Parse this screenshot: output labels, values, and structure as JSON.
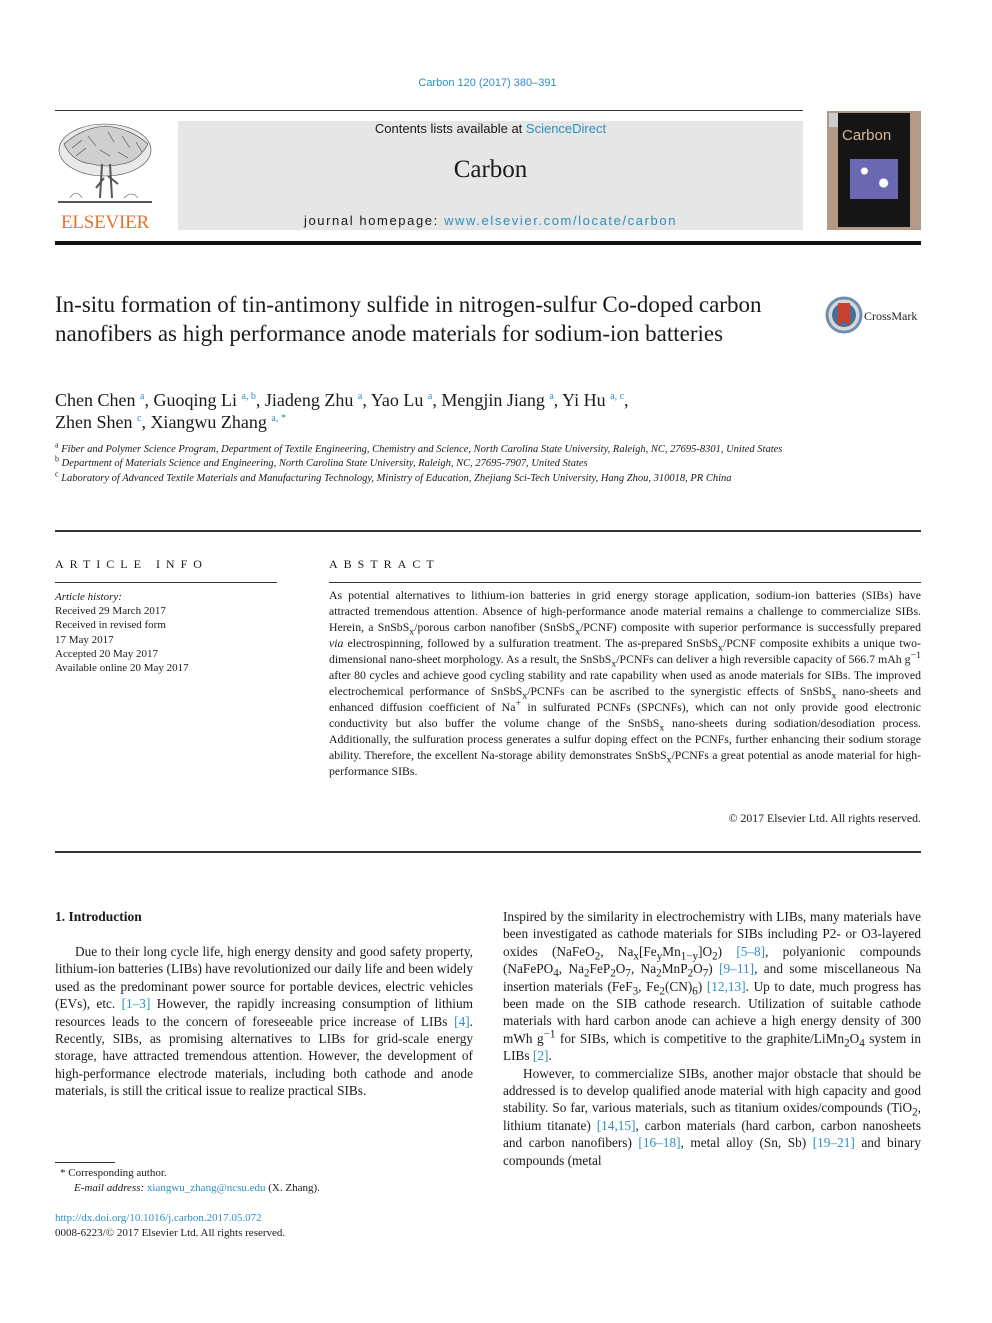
{
  "citation": "Carbon 120 (2017) 380–391",
  "header": {
    "publisher_logo_text": "ELSEVIER",
    "contents_prefix": "Contents lists available at ",
    "contents_link": "ScienceDirect",
    "journal_name": "Carbon",
    "homepage_prefix": "journal homepage: ",
    "homepage_link": "www.elsevier.com/locate/carbon",
    "cover_title": "Carbon",
    "colors": {
      "link": "#2c8fbf",
      "elsevier_orange": "#e8722d",
      "header_box": "#e6e6e6",
      "cover_frame": "#b39a86"
    }
  },
  "article": {
    "title": "In-situ formation of tin-antimony sulfide in nitrogen-sulfur Co-doped carbon nanofibers as high performance anode materials for sodium-ion batteries",
    "crossmark_label": "CrossMark",
    "authors": [
      {
        "name": "Chen Chen",
        "aff": "a"
      },
      {
        "name": "Guoqing Li",
        "aff": "a, b"
      },
      {
        "name": "Jiadeng Zhu",
        "aff": "a"
      },
      {
        "name": "Yao Lu",
        "aff": "a"
      },
      {
        "name": "Mengjin Jiang",
        "aff": "a"
      },
      {
        "name": "Yi Hu",
        "aff": "a, c"
      },
      {
        "name": "Zhen Shen",
        "aff": "c"
      },
      {
        "name": "Xiangwu Zhang",
        "aff": "a, *"
      }
    ],
    "affiliations": [
      {
        "key": "a",
        "text": "Fiber and Polymer Science Program, Department of Textile Engineering, Chemistry and Science, North Carolina State University, Raleigh, NC, 27695-8301, United States"
      },
      {
        "key": "b",
        "text": "Department of Materials Science and Engineering, North Carolina State University, Raleigh, NC, 27695-7907, United States"
      },
      {
        "key": "c",
        "text": "Laboratory of Advanced Textile Materials and Manufacturing Technology, Ministry of Education, Zhejiang Sci-Tech University, Hang Zhou, 310018, PR China"
      }
    ]
  },
  "article_info": {
    "heading": "ARTICLE INFO",
    "history_label": "Article history:",
    "history": [
      "Received 29 March 2017",
      "Received in revised form",
      "17 May 2017",
      "Accepted 20 May 2017",
      "Available online 20 May 2017"
    ]
  },
  "abstract": {
    "heading": "ABSTRACT",
    "s1": "As potential alternatives to lithium-ion batteries in grid energy storage application, sodium-ion batteries (SIBs) have attracted tremendous attention. Absence of high-performance anode material remains a challenge to commercialize SIBs. Herein, a SnSbS",
    "s2": "/porous carbon nanofiber (SnSbS",
    "s3": "/PCNF) composite with superior performance is successfully prepared ",
    "s3_via": "via",
    "s4": " electrospinning, followed by a sulfuration treatment. The as-prepared SnSbS",
    "s5": "/PCNF composite exhibits a unique two-dimensional nano-sheet morphology. As a result, the SnSbS",
    "s6": "/PCNFs can deliver a high reversible capacity of 566.7 mAh g",
    "s7": " after 80 cycles and achieve good cycling stability and rate capability when used as anode materials for SIBs. The improved electrochemical performance of SnSbS",
    "s8": "/PCNFs can be ascribed to the synergistic effects of SnSbS",
    "s9": " nano-sheets and enhanced diffusion coefficient of Na",
    "s10": " in sulfurated PCNFs (SPCNFs), which can not only provide good electronic conductivity but also buffer the volume change of the SnSbS",
    "s11": " nano-sheets during sodiation/desodiation process. Additionally, the sulfuration process generates a sulfur doping effect on the PCNFs, further enhancing their sodium storage ability. Therefore, the excellent Na-storage ability demonstrates SnSbS",
    "s12": "/PCNFs a great potential as anode material for high-performance SIBs.",
    "sub_x": "x",
    "sup_minus1": "−1",
    "sup_plus": "+",
    "copyright": "© 2017 Elsevier Ltd. All rights reserved."
  },
  "introduction": {
    "heading": "1.  Introduction",
    "left_p1_a": "Due to their long cycle life, high energy density and good safety property, lithium-ion batteries (LIBs) have revolutionized our daily life and been widely used as the predominant power source for portable devices, electric vehicles (EVs), etc. ",
    "ref_1_3": "[1–3]",
    "left_p1_b": " However, the rapidly increasing consumption of lithium resources leads to the concern of foreseeable price increase of LIBs ",
    "ref_4": "[4]",
    "left_p1_c": ". Recently, SIBs, as promising alternatives to LIBs for grid-scale energy storage, have attracted tremendous attention. However, the development of high-performance electrode materials, including both cathode and anode materials, is still the critical issue to realize practical SIBs.",
    "right_p1_a": "Inspired by the similarity in electrochemistry with LIBs, many materials have been investigated as cathode materials for SIBs including P2- or O3-layered oxides (NaFeO",
    "right_p1_b": ", Na",
    "right_p1_c": "[Fe",
    "right_p1_d": "Mn",
    "right_p1_e": "]O",
    "right_p1_f": ") ",
    "ref_5_8": "[5–8]",
    "right_p1_g": ", polyanionic compounds (NaFePO",
    "right_p1_h": ", Na",
    "right_p1_i": "FeP",
    "right_p1_j": "O",
    "right_p1_k": ", Na",
    "right_p1_l": "MnP",
    "right_p1_m": "O",
    "right_p1_n": ") ",
    "ref_9_11": "[9–11]",
    "right_p1_o": ", and some miscellaneous Na insertion materials (FeF",
    "right_p1_p": ", Fe",
    "right_p1_q": "(CN)",
    "right_p1_r": ") ",
    "ref_12_13": "[12,13]",
    "right_p1_s": ". Up to date, much progress has been made on the SIB cathode research. Utilization of suitable cathode materials with hard carbon anode can achieve a high energy density of 300 mWh g",
    "right_p1_t": " for SIBs, which is competitive to the graphite/LiMn",
    "right_p1_u": "O",
    "right_p1_v": " system in LIBs ",
    "ref_2": "[2]",
    "right_p1_w": ".",
    "right_p2_a": "However, to commercialize SIBs, another major obstacle that should be addressed is to develop qualified anode material with high capacity and good stability. So far, various materials, such as titanium oxides/compounds (TiO",
    "right_p2_b": ", lithium titanate) ",
    "ref_14_15": "[14,15]",
    "right_p2_c": ", carbon materials (hard carbon, carbon nanosheets and carbon nanofibers) ",
    "ref_16_18": "[16–18]",
    "right_p2_d": ", metal alloy (Sn, Sb) ",
    "ref_19_21": "[19–21]",
    "right_p2_e": " and binary compounds (metal",
    "subs": {
      "x": "x",
      "y": "y",
      "one_minus_y": "1−y",
      "2": "2",
      "3": "3",
      "4": "4",
      "6": "6",
      "7": "7",
      "minus1": "−1"
    }
  },
  "footnotes": {
    "corresponding": "* Corresponding author.",
    "email_label": "E-mail address: ",
    "email": "xiangwu_zhang@ncsu.edu",
    "email_suffix": " (X. Zhang).",
    "doi": "http://dx.doi.org/10.1016/j.carbon.2017.05.072",
    "issn_line": "0008-6223/© 2017 Elsevier Ltd. All rights reserved."
  }
}
